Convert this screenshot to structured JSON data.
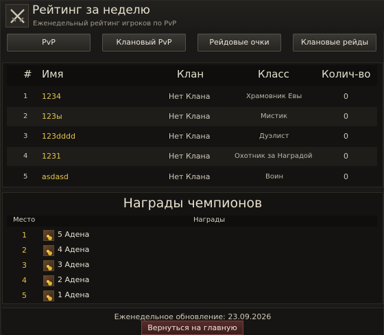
{
  "header": {
    "title": "Рейтинг за неделю",
    "subtitle": "Еженедельный рейтинг игроков по PvP",
    "icon": "crossed-swords-icon"
  },
  "tabs": [
    "PvP",
    "Клановый PvP",
    "Рейдовые очки",
    "Клановые рейды"
  ],
  "table": {
    "columns": [
      "#",
      "Имя",
      "Клан",
      "Класс",
      "Колич-во"
    ],
    "rows": [
      {
        "rank": "1",
        "name": "1234",
        "clan": "Нет Клана",
        "class": "Храмовник Евы",
        "count": "0"
      },
      {
        "rank": "2",
        "name": "123ы",
        "clan": "Нет Клана",
        "class": "Мистик",
        "count": "0"
      },
      {
        "rank": "3",
        "name": "123dddd",
        "clan": "Нет Клана",
        "class": "Дуэлист",
        "count": "0"
      },
      {
        "rank": "4",
        "name": "1231",
        "clan": "Нет Клана",
        "class": "Охотник за Наградой",
        "count": "0"
      },
      {
        "rank": "5",
        "name": "asdasd",
        "clan": "Нет Клана",
        "class": "Воин",
        "count": "0"
      }
    ]
  },
  "rewards": {
    "title": "Награды чемпионов",
    "columns": [
      "Место",
      "Награды"
    ],
    "rows": [
      {
        "place": "1",
        "reward": "5 Адена",
        "icon": "adena-coins-icon"
      },
      {
        "place": "2",
        "reward": "4 Адена",
        "icon": "adena-coins-icon"
      },
      {
        "place": "3",
        "reward": "3 Адена",
        "icon": "adena-coins-icon"
      },
      {
        "place": "4",
        "reward": "2 Адена",
        "icon": "adena-coins-icon"
      },
      {
        "place": "5",
        "reward": "1 Адена",
        "icon": "adena-coins-icon"
      }
    ]
  },
  "footer": {
    "update": "Еженедельное обновление: 23.09.2026",
    "back_button": "Вернуться на главную"
  },
  "colors": {
    "name_gold": "#e2c24c",
    "background": "#1a1917",
    "back_button": "#5a2b2b"
  }
}
